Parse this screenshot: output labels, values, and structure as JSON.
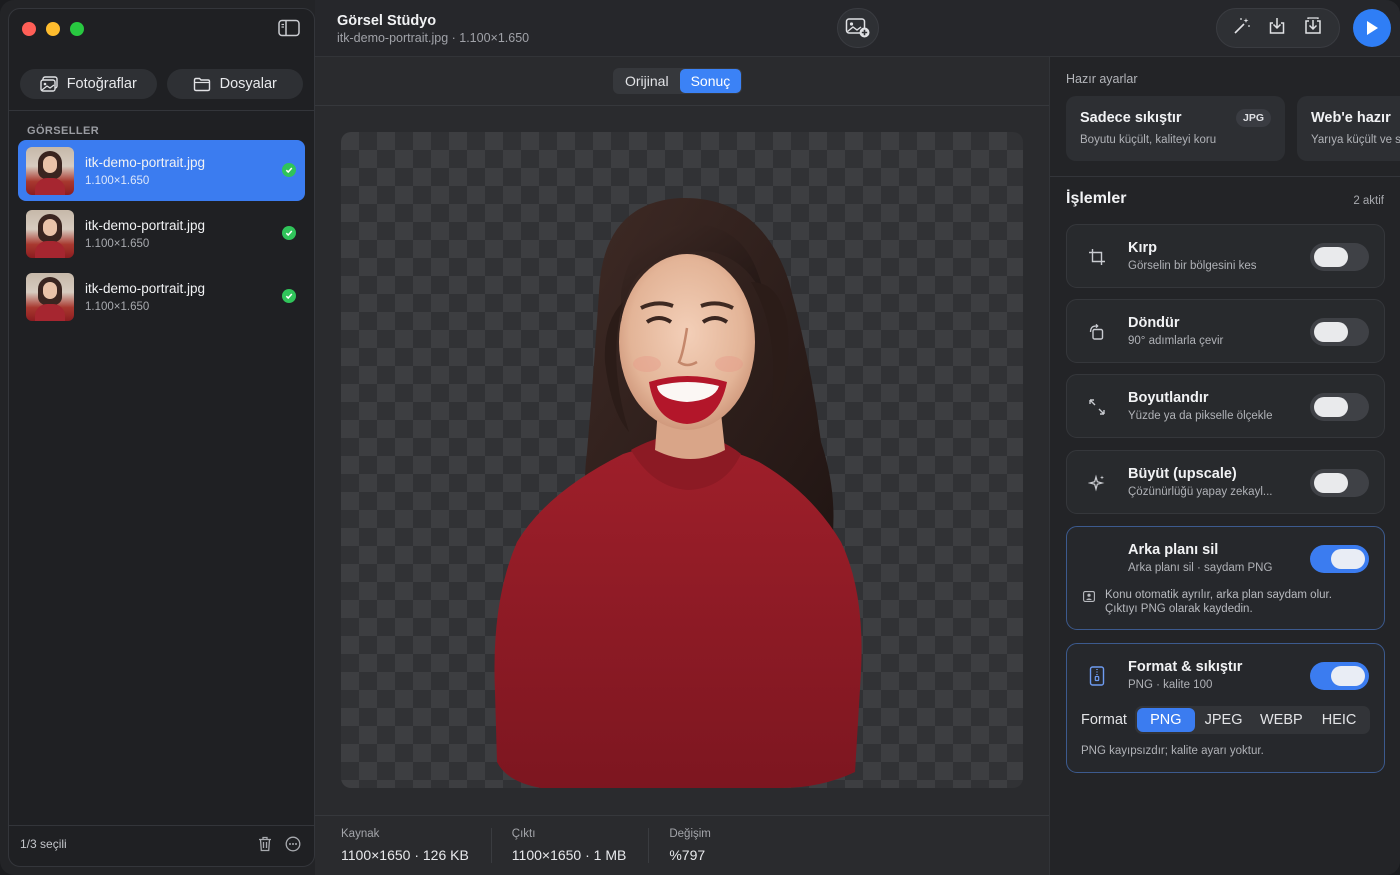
{
  "sidebar": {
    "tabs": [
      {
        "label": "Fotoğraflar",
        "icon": "photos-icon"
      },
      {
        "label": "Dosyalar",
        "icon": "folder-icon"
      }
    ],
    "section_title": "GÖRSELLER",
    "files": [
      {
        "name": "itk-demo-portrait.jpg",
        "dims": "1.100×1.650",
        "selected": true,
        "status": "done"
      },
      {
        "name": "itk-demo-portrait.jpg",
        "dims": "1.100×1.650",
        "selected": false,
        "status": "done"
      },
      {
        "name": "itk-demo-portrait.jpg",
        "dims": "1.100×1.650",
        "selected": false,
        "status": "done"
      }
    ],
    "footer": {
      "selection": "1/3 seçili"
    }
  },
  "header": {
    "title": "Görsel Stüdyo",
    "subtitle": "itk-demo-portrait.jpg · 1.100×1.650"
  },
  "viewer": {
    "segments": [
      "Orijinal",
      "Sonuç"
    ],
    "active_segment": "Sonuç",
    "stats": [
      {
        "label": "Kaynak",
        "value": "1100×1650 · 126 KB"
      },
      {
        "label": "Çıktı",
        "value": "1100×1650 · 1 MB"
      },
      {
        "label": "Değişim",
        "value": "%797"
      }
    ]
  },
  "presets": {
    "title": "Hazır ayarlar",
    "items": [
      {
        "name": "Sadece sıkıştır",
        "desc": "Boyutu küçült, kaliteyi koru",
        "badge": "JPG"
      },
      {
        "name": "Web'e hazır",
        "desc": "Yarıya küçült ve sıkıştır",
        "badge": ""
      }
    ]
  },
  "operations": {
    "title": "İşlemler",
    "count": "2 aktif",
    "items": [
      {
        "key": "crop",
        "title": "Kırp",
        "desc": "Görselin bir bölgesini kes",
        "enabled": false
      },
      {
        "key": "rotate",
        "title": "Döndür",
        "desc": "90° adımlarla çevir",
        "enabled": false
      },
      {
        "key": "resize",
        "title": "Boyutlandır",
        "desc": "Yüzde ya da pikselle ölçekle",
        "enabled": false
      },
      {
        "key": "upscale",
        "title": "Büyüt (upscale)",
        "desc": "Çözünürlüğü yapay zekayl...",
        "enabled": false
      },
      {
        "key": "bg-remove",
        "title": "Arka planı sil",
        "desc": "Arka planı sil · saydam PNG",
        "enabled": true,
        "note_line1": "Konu otomatik ayrılır, arka plan saydam olur.",
        "note_line2": "Çıktıyı PNG olarak kaydedin."
      },
      {
        "key": "format",
        "title": "Format & sıkıştır",
        "desc": "PNG · kalite 100",
        "enabled": true,
        "format_label": "Format",
        "formats": [
          "PNG",
          "JPEG",
          "WEBP",
          "HEIC"
        ],
        "selected_format": "PNG",
        "note": "PNG kayıpsızdır; kalite ayarı yoktur."
      }
    ]
  },
  "colors": {
    "accent": "#3b7cf0",
    "success": "#30c45a",
    "play": "#2f7ef6"
  }
}
